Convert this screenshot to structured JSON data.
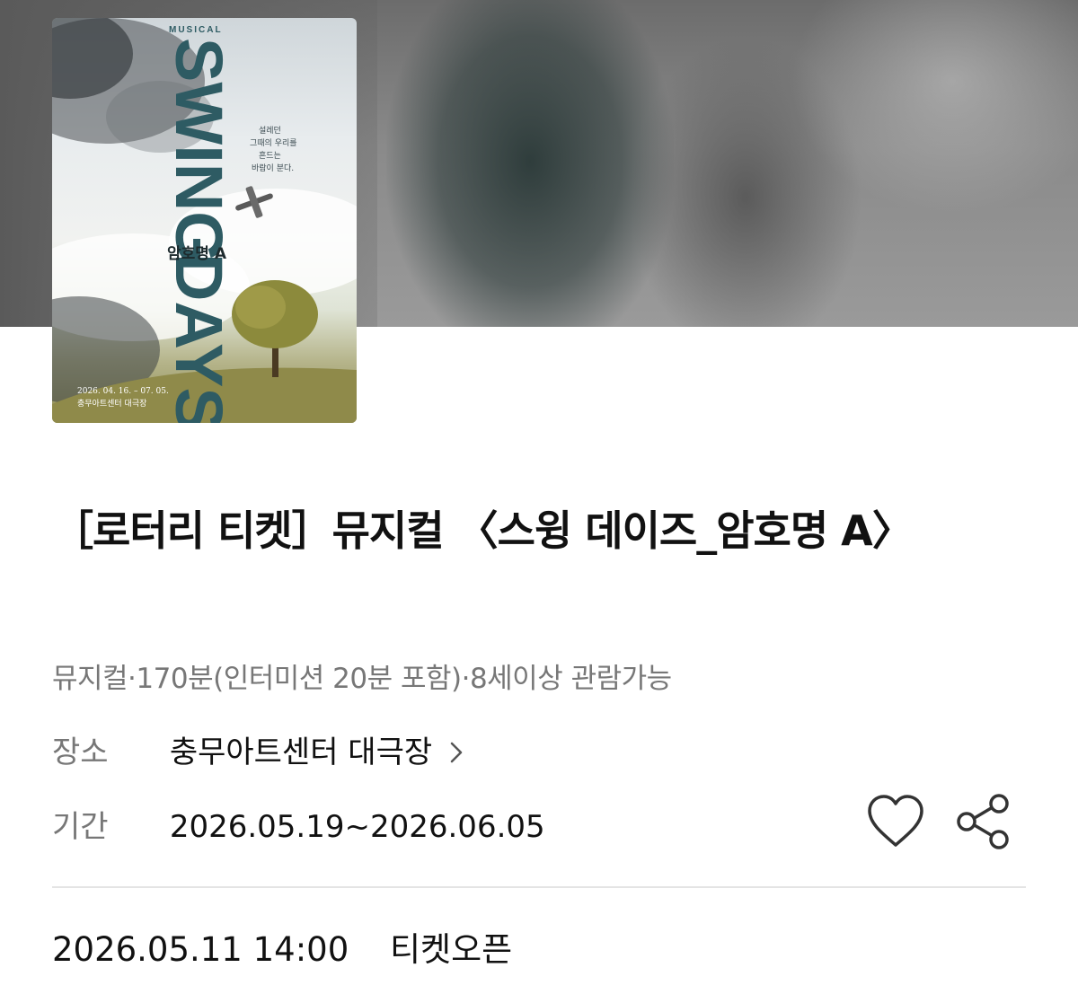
{
  "poster": {
    "kicker": "MUSICAL",
    "headline_top": "SWING",
    "headline_bottom": "DAYS",
    "subtitle": "암호명 A",
    "tagline": [
      "설레던",
      "그때의 우리를",
      "흔드는",
      "바람이 분다."
    ],
    "date_range": "2026. 04. 16. – 07. 05.",
    "venue": "충무아트센터 대극장"
  },
  "event": {
    "title": "［로터리 티켓］뮤지컬 〈스윙 데이즈_암호명 A〉",
    "subinfo": "뮤지컬·170분(인터미션 20분 포함)·8세이상 관람가능",
    "venue_label": "장소",
    "venue_value": "충무아트센터 대극장",
    "period_label": "기간",
    "period_value": "2026.05.19~2026.06.05"
  },
  "ticket_open": {
    "datetime": "2026.05.11 14:00",
    "label": "티켓오픈"
  },
  "icons": {
    "venue_arrow": "chevron-right-icon",
    "like": "heart-icon",
    "share": "share-icon"
  },
  "colors": {
    "text_primary": "#111111",
    "text_secondary": "#777777",
    "poster_headline": "#2e5b63"
  }
}
